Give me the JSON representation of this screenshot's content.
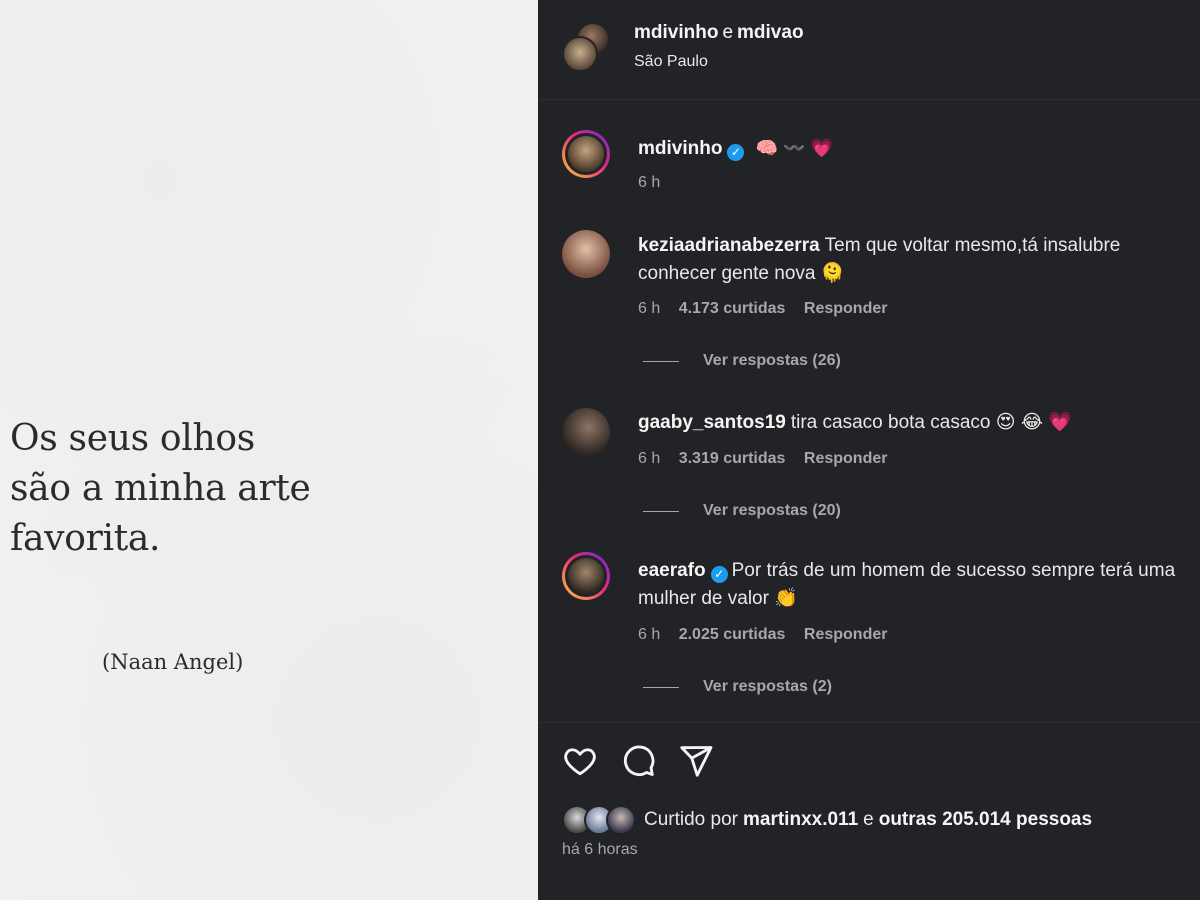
{
  "post_image": {
    "quote_lines": [
      "Os seus olhos",
      "são a minha arte",
      "favorita."
    ],
    "author": "(Naan Angel)"
  },
  "header": {
    "user1": "mdivinho",
    "connector": "e",
    "user2": "mdivao",
    "location": "São Paulo"
  },
  "caption": {
    "user": "mdivinho",
    "emojis": "🧠 〰️ 💗",
    "time": "6 h"
  },
  "comments": [
    {
      "user": "keziaadrianabezerra",
      "text": "Tem que voltar mesmo,tá insalubre conhecer gente nova 🫠",
      "time": "6 h",
      "likes": "4.173 curtidas",
      "reply": "Responder",
      "view_replies": "Ver respostas (26)"
    },
    {
      "user": "gaaby_santos19",
      "text": "tira casaco bota casaco 😍 😂 💗",
      "time": "6 h",
      "likes": "3.319 curtidas",
      "reply": "Responder",
      "view_replies": "Ver respostas (20)"
    },
    {
      "user": "eaerafo",
      "text": "Por trás de um homem de sucesso sempre terá uma mulher de valor 👏",
      "time": "6 h",
      "likes": "2.025 curtidas",
      "reply": "Responder",
      "view_replies": "Ver respostas (2)"
    }
  ],
  "likes": {
    "prefix": "Curtido por",
    "user": "martinxx.011",
    "connector": "e",
    "others": "outras 205.014 pessoas"
  },
  "posted": "há 6 horas",
  "icons": {
    "like": "heart-icon",
    "comment": "comment-icon",
    "share": "share-icon"
  }
}
